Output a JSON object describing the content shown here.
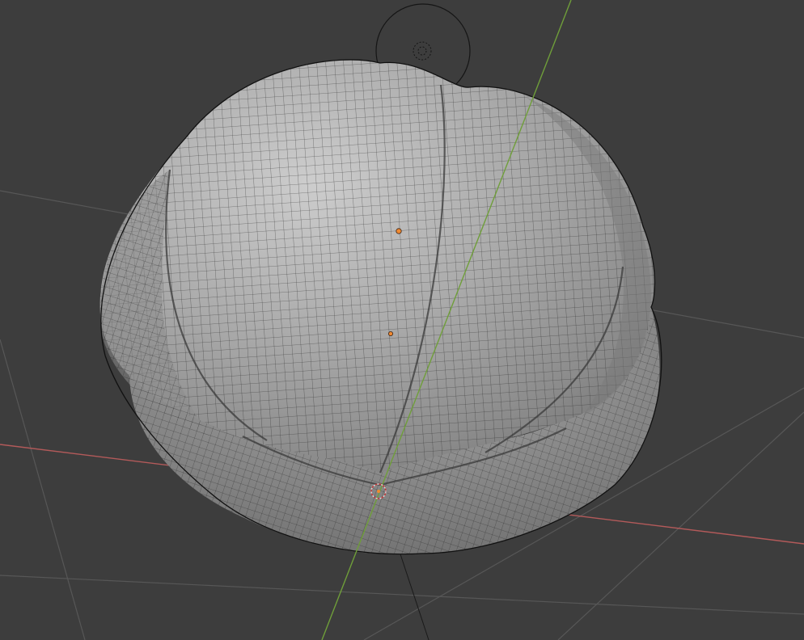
{
  "viewport": {
    "background": "#3d3d3d",
    "grid_color": "#595959",
    "x_axis_color": "#c15a5a",
    "y_axis_color": "#6f9e3a",
    "mesh_wire_color": "#1c1c1c",
    "mesh_fill_light": "#c7c7c7",
    "mesh_fill_dark": "#6a6a6a",
    "vertex_selected_color": "#f08a32",
    "object_origin_icon": "origin-crosshair-icon",
    "camera_target_icon": "light-gizmo-icon"
  }
}
